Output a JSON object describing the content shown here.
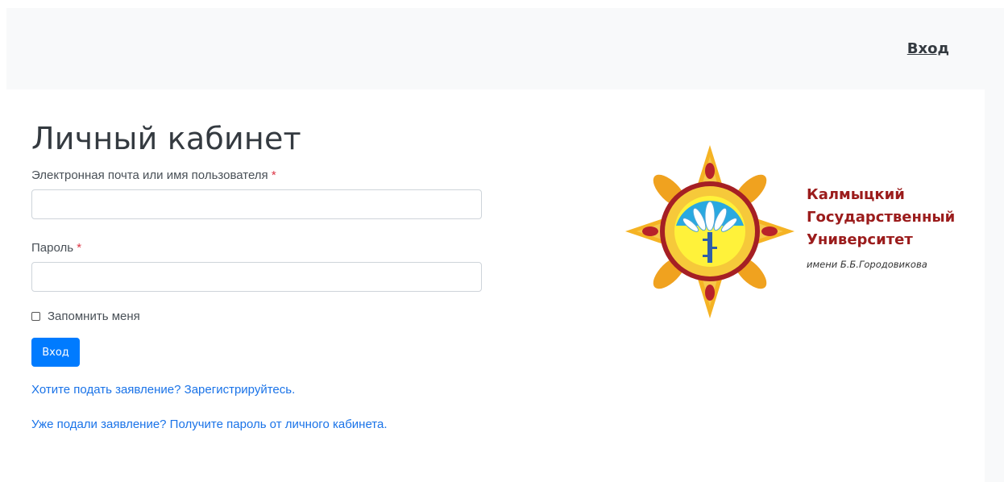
{
  "nav": {
    "login_link": "Вход"
  },
  "form": {
    "title": "Личный кабинет",
    "email_label": "Электронная почта или имя пользователя",
    "password_label": "Пароль",
    "required_mark": "*",
    "email_value": "",
    "password_value": "",
    "remember_label": "Запомнить меня",
    "remember_checked": false,
    "submit_label": "Вход"
  },
  "links": {
    "register": "Хотите подать заявление? Зарегистрируйтесь.",
    "get_password": "Уже подали заявление? Получите пароль от личного кабинета."
  },
  "logo": {
    "name_lines": [
      "Калмыцкий",
      "Государственный",
      "Университет"
    ],
    "subtitle": "имени Б.Б.Городовикова",
    "name_color": "#9b1c1c"
  },
  "colors": {
    "primary_button": "#007bff",
    "link": "#1a73e8",
    "required": "#dc3545",
    "header_bg": "#f8f9fa"
  }
}
